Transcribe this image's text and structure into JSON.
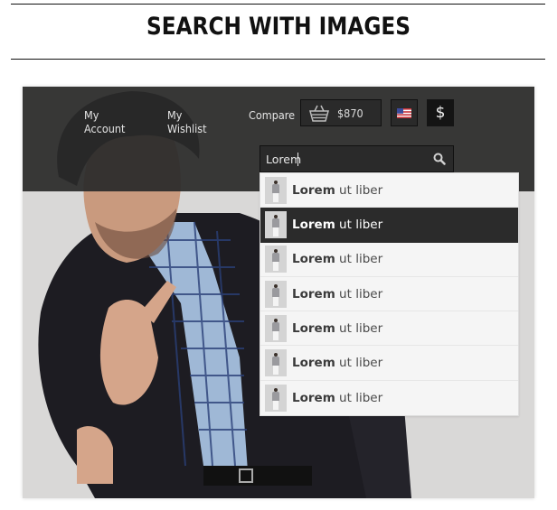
{
  "page": {
    "title": "SEARCH WITH IMAGES"
  },
  "header": {
    "nav": [
      {
        "label": "My Account"
      },
      {
        "label": "My Wishlist"
      },
      {
        "label": "Compare"
      }
    ],
    "cart": {
      "icon": "basket-icon",
      "amount": "$870"
    },
    "language": {
      "icon": "us-flag-icon"
    },
    "currency": {
      "symbol": "$"
    }
  },
  "search": {
    "value": "Lorem",
    "icon": "search-icon",
    "active_index": 1,
    "results": [
      {
        "bold": "Lorem",
        "rest": " ut liber",
        "thumb": "product-thumbnail"
      },
      {
        "bold": "Lorem",
        "rest": " ut liber",
        "thumb": "product-thumbnail"
      },
      {
        "bold": "Lorem",
        "rest": " ut liber",
        "thumb": "product-thumbnail"
      },
      {
        "bold": "Lorem",
        "rest": " ut liber",
        "thumb": "product-thumbnail"
      },
      {
        "bold": "Lorem",
        "rest": " ut liber",
        "thumb": "product-thumbnail"
      },
      {
        "bold": "Lorem",
        "rest": " ut liber",
        "thumb": "product-thumbnail"
      },
      {
        "bold": "Lorem",
        "rest": " ut liber",
        "thumb": "product-thumbnail"
      }
    ]
  },
  "colors": {
    "header_bg": "#2a2a2a",
    "dropdown_bg": "#f5f5f5",
    "active_row_bg": "#2b2b2b",
    "hero_bg": "#d9d8d7"
  }
}
